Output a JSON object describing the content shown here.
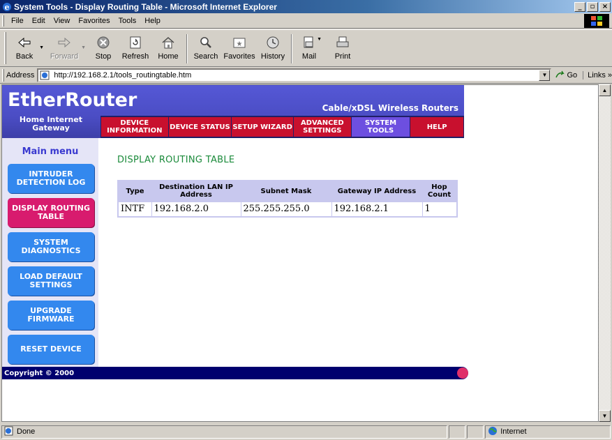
{
  "window": {
    "title": "System Tools - Display Routing Table - Microsoft Internet Explorer",
    "controls": [
      "minimize",
      "maximize",
      "close"
    ]
  },
  "menubar": {
    "items": [
      "File",
      "Edit",
      "View",
      "Favorites",
      "Tools",
      "Help"
    ]
  },
  "toolbar": {
    "buttons": [
      {
        "label": "Back",
        "icon": "back-arrow-icon",
        "enabled": true
      },
      {
        "label": "Forward",
        "icon": "forward-arrow-icon",
        "enabled": false
      },
      {
        "label": "Stop",
        "icon": "stop-icon",
        "enabled": true
      },
      {
        "label": "Refresh",
        "icon": "refresh-icon",
        "enabled": true
      },
      {
        "label": "Home",
        "icon": "home-icon",
        "enabled": true
      },
      {
        "label": "Search",
        "icon": "search-icon",
        "enabled": true
      },
      {
        "label": "Favorites",
        "icon": "favorites-icon",
        "enabled": true
      },
      {
        "label": "History",
        "icon": "history-icon",
        "enabled": true
      },
      {
        "label": "Mail",
        "icon": "mail-icon",
        "enabled": true
      },
      {
        "label": "Print",
        "icon": "print-icon",
        "enabled": true
      }
    ]
  },
  "addressbar": {
    "label": "Address",
    "url": "http://192.168.2.1/tools_routingtable.htm",
    "go_label": "Go",
    "links_label": "Links »"
  },
  "page": {
    "brand": "EtherRouter",
    "tagline": "Cable/xDSL Wireless Routers",
    "subbrand": "Home Internet Gateway",
    "nav": [
      {
        "label": "DEVICE INFORMATION",
        "active": false
      },
      {
        "label": "DEVICE STATUS",
        "active": false
      },
      {
        "label": "SETUP WIZARD",
        "active": false
      },
      {
        "label": "ADVANCED SETTINGS",
        "active": false
      },
      {
        "label": "SYSTEM TOOLS",
        "active": true
      },
      {
        "label": "HELP",
        "active": false
      }
    ],
    "sidebar_title": "Main menu",
    "sidebar": [
      {
        "label": "INTRUDER DETECTION LOG",
        "active": false
      },
      {
        "label": "DISPLAY ROUTING TABLE",
        "active": true
      },
      {
        "label": "SYSTEM DIAGNOSTICS",
        "active": false
      },
      {
        "label": "LOAD DEFAULT SETTINGS",
        "active": false
      },
      {
        "label": "UPGRADE FIRMWARE",
        "active": false
      },
      {
        "label": "RESET DEVICE",
        "active": false
      }
    ],
    "section_title": "DISPLAY ROUTING TABLE",
    "table": {
      "headers": [
        "Type",
        "Destination LAN IP Address",
        "Subnet Mask",
        "Gateway IP Address",
        "Hop Count"
      ],
      "rows": [
        [
          "INTF",
          "192.168.2.0",
          "255.255.255.0",
          "192.168.2.1",
          "1"
        ]
      ]
    },
    "footer": "Copyright © 2000"
  },
  "statusbar": {
    "status": "Done",
    "zone": "Internet"
  },
  "colors": {
    "header_bg": "#4b4dc4",
    "nav_button": "#c8102e",
    "nav_active": "#6d4fe0",
    "sidebar_button": "#3388ee",
    "sidebar_active": "#d81b6e",
    "section_title": "#1a8a3a",
    "footer_bg": "#00006e"
  }
}
